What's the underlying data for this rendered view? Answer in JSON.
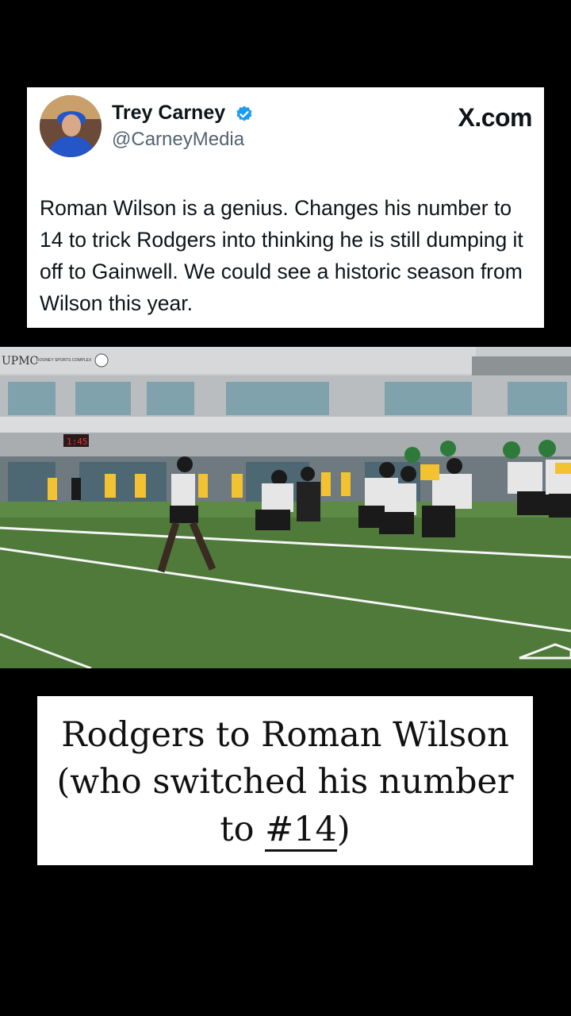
{
  "tweet": {
    "author_name": "Trey Carney",
    "author_handle": "@CarneyMedia",
    "source": "X.com",
    "text": "Roman Wilson is a genius. Changes his number to 14 to trick Rodgers into thinking he is still dumping it off to Gainwell. We could see a historic season from Wilson this year."
  },
  "photo": {
    "building_sign": "UPMC",
    "building_sign_sub": "ROONEY SPORTS COMPLEX",
    "scoreboard_text": "1:45"
  },
  "caption": {
    "line1": "Rodgers to Roman Wilson",
    "line2": "(who switched his number",
    "line3_prefix": "to ",
    "line3_highlight": "#14",
    "line3_suffix": ")"
  },
  "colors": {
    "verified_blue": "#1d9bf0",
    "field_green": "#4f7a3a",
    "steelers_gold": "#f2c230"
  }
}
